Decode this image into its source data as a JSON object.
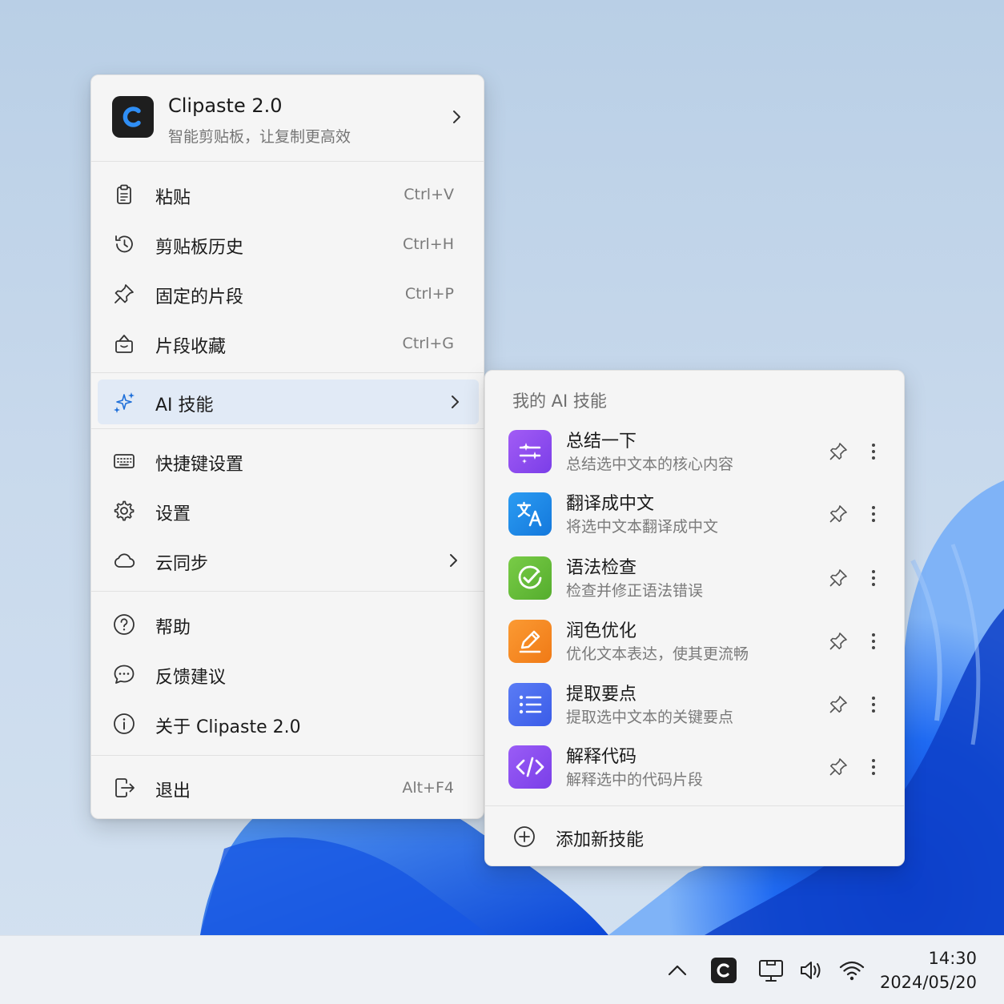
{
  "app": {
    "name": "Clipaste 2.0",
    "tagline": "智能剪贴板，让复制更高效",
    "logo_letter": "C"
  },
  "menu": {
    "group1": [
      {
        "label": "粘贴",
        "shortcut": "Ctrl+V",
        "icon": "clipboard-icon"
      },
      {
        "label": "剪贴板历史",
        "shortcut": "Ctrl+H",
        "icon": "history-icon"
      },
      {
        "label": "固定的片段",
        "shortcut": "Ctrl+P",
        "icon": "pin-icon"
      },
      {
        "label": "片段收藏",
        "shortcut": "Ctrl+G",
        "icon": "bag-icon"
      }
    ],
    "ai": {
      "label": "AI 技能",
      "icon": "sparkle-icon"
    },
    "group2": [
      {
        "label": "快捷键设置",
        "icon": "keyboard-icon"
      },
      {
        "label": "设置",
        "icon": "gear-icon"
      },
      {
        "label": "云同步",
        "icon": "cloud-icon"
      }
    ],
    "group3": [
      {
        "label": "帮助",
        "icon": "help-icon"
      },
      {
        "label": "反馈建议",
        "icon": "chat-icon"
      },
      {
        "label": "关于 Clipaste 2.0",
        "icon": "info-icon"
      }
    ],
    "exit": {
      "label": "退出",
      "shortcut": "Alt+F4",
      "icon": "exit-icon"
    }
  },
  "submenu": {
    "title": "我的 AI 技能",
    "skills": [
      {
        "name": "总结一下",
        "desc": "总结选中文本的核心内容",
        "icon": "summarize-icon",
        "color": "#8e4ff0"
      },
      {
        "name": "翻译成中文",
        "desc": "将选中文本翻译成中文",
        "icon": "translate-icon",
        "color": "#1e8be8"
      },
      {
        "name": "语法检查",
        "desc": "检查并修正语法错误",
        "icon": "check-icon",
        "color": "#6cc03c"
      },
      {
        "name": "润色优化",
        "desc": "优化文本表达，使其更流畅",
        "icon": "pen-icon",
        "color": "#f58a22"
      },
      {
        "name": "提取要点",
        "desc": "提取选中文本的关键要点",
        "icon": "list-icon",
        "color": "#4a6cf0"
      },
      {
        "name": "解释代码",
        "desc": "解释选中的代码片段",
        "icon": "code-icon",
        "color": "#8a4ff2"
      }
    ],
    "add_label": "添加新技能"
  },
  "taskbar": {
    "time": "14:30",
    "date": "2024/05/20",
    "icons": [
      "chevron-up-icon",
      "clipaste-tray-icon",
      "monitor-icon",
      "volume-icon",
      "wifi-icon"
    ]
  }
}
